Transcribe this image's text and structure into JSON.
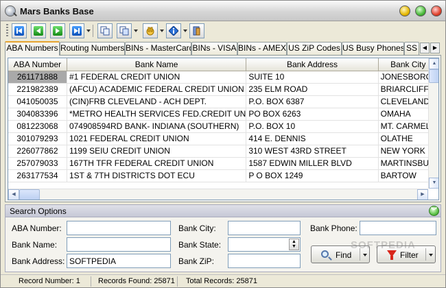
{
  "window": {
    "title": "Mars Banks Base"
  },
  "toolbar": {
    "buttons": [
      {
        "name": "first-record-icon"
      },
      {
        "name": "prev-record-icon"
      },
      {
        "name": "next-record-icon"
      },
      {
        "name": "last-record-icon"
      },
      {
        "name": "copy-icon"
      },
      {
        "name": "copy-all-icon"
      },
      {
        "name": "hand-icon"
      },
      {
        "name": "info-icon"
      },
      {
        "name": "exit-door-icon"
      }
    ]
  },
  "tabs": [
    {
      "label": "ABA Numbers",
      "active": true
    },
    {
      "label": "Routing Numbers"
    },
    {
      "label": "BINs - MasterCard"
    },
    {
      "label": "BINs - VISA"
    },
    {
      "label": "BINs - AMEX"
    },
    {
      "label": "US ZiP Codes"
    },
    {
      "label": "US Busy Phones"
    },
    {
      "label": "SS"
    }
  ],
  "grid": {
    "columns": [
      "ABA Number",
      "Bank Name",
      "Bank Address",
      "Bank City"
    ],
    "rows": [
      [
        "261171888",
        "#1 FEDERAL CREDIT UNION",
        "SUITE 10",
        "JONESBORO"
      ],
      [
        "221982389",
        "(AFCU) ACADEMIC FEDERAL CREDIT UNION",
        "235 ELM ROAD",
        "BRIARCLIFF M"
      ],
      [
        "041050035",
        "(CIN)FRB CLEVELAND - ACH DEPT.",
        "P.O. BOX 6387",
        "CLEVELAND"
      ],
      [
        "304083396",
        "*METRO HEALTH SERVICES FED.CREDIT UN",
        "PO BOX 6263",
        "OMAHA"
      ],
      [
        "081223068",
        "074908594RD BANK- INDIANA (SOUTHERN)",
        "P.O. BOX 10",
        "MT. CARMEL"
      ],
      [
        "301079293",
        "1021 FEDERAL CREDIT UNION",
        "414 E. DENNIS",
        "OLATHE"
      ],
      [
        "226077862",
        "1199 SEIU CREDIT UNION",
        "310 WEST 43RD STREET",
        "NEW YORK"
      ],
      [
        "257079033",
        "167TH TFR FEDERAL CREDIT UNION",
        "1587 EDWIN MILLER BLVD",
        "MARTINSBUR"
      ],
      [
        "263177534",
        "1ST & 7TH DISTRICTS DOT ECU",
        "P O BOX 1249",
        "BARTOW"
      ]
    ]
  },
  "search": {
    "header": "Search Options",
    "aba_label": "ABA Number:",
    "aba_value": "",
    "name_label": "Bank Name:",
    "name_value": "",
    "address_label": "Bank Address:",
    "address_value": "SOFTPEDIA",
    "city_label": "Bank City:",
    "city_value": "",
    "state_label": "Bank State:",
    "state_value": "",
    "zip_label": "Bank ZiP:",
    "zip_value": "",
    "phone_label": "Bank Phone:",
    "phone_value": "",
    "find_label": "Find",
    "filter_label": "Filter"
  },
  "status": {
    "record_number": "Record Number: 1",
    "records_found": "Records Found: 25871",
    "total_records": "Total Records: 25871"
  },
  "watermark": "SOFTPEDIA"
}
